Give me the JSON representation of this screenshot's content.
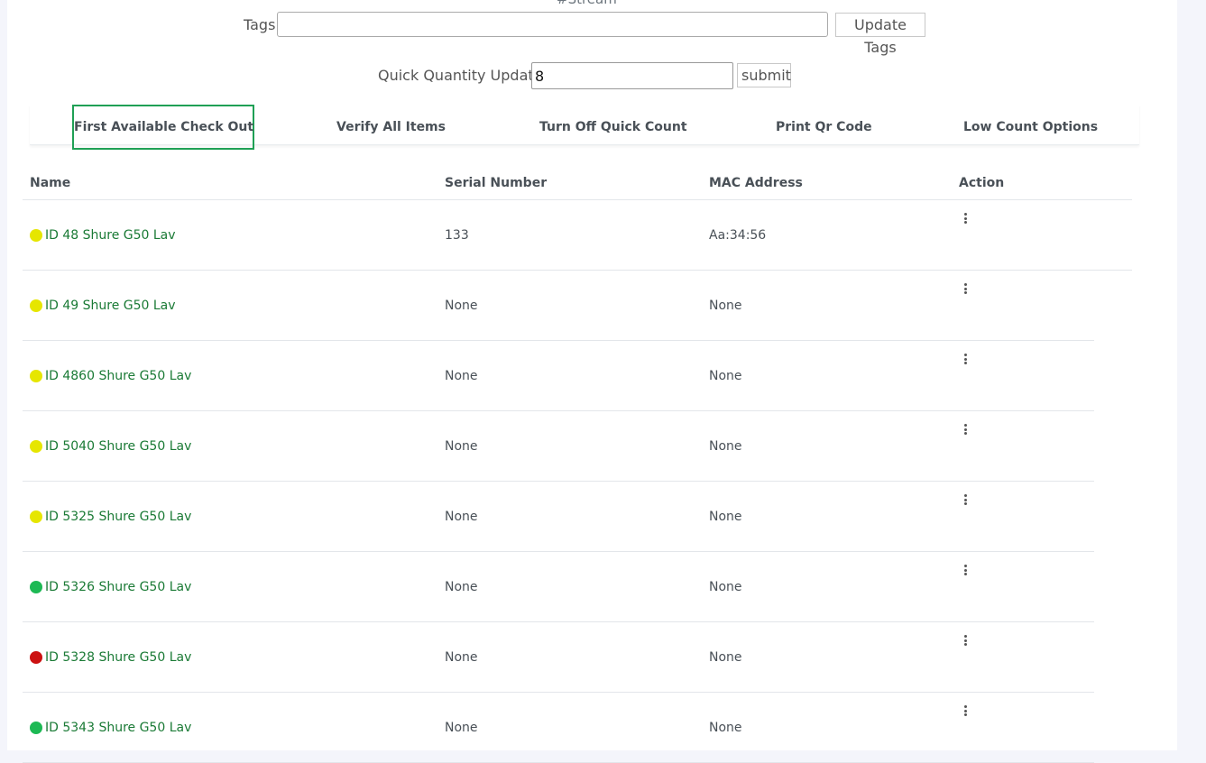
{
  "header": {
    "stream_label": "#Stream",
    "tags_label": "Tags",
    "tags_value": "",
    "update_tags_label": "Update Tags",
    "quick_quantity_label": "Quick Quantity Update",
    "quick_quantity_value": "8",
    "submit_label": "submit"
  },
  "tabs": [
    {
      "label": "First Available Check Out",
      "active": true
    },
    {
      "label": "Verify All Items",
      "active": false
    },
    {
      "label": "Turn Off Quick Count",
      "active": false
    },
    {
      "label": "Print Qr Code",
      "active": false
    },
    {
      "label": "Low Count Options",
      "active": false
    }
  ],
  "table": {
    "columns": [
      "Name",
      "Serial Number",
      "MAC Address",
      "Action"
    ],
    "rows": [
      {
        "name": "ID 48 Shure G50 Lav",
        "serial": "133",
        "mac": "Aa:34:56",
        "status_color": "#e6e600"
      },
      {
        "name": "ID 49 Shure G50 Lav",
        "serial": "None",
        "mac": "None",
        "status_color": "#e6e600"
      },
      {
        "name": "ID 4860 Shure G50 Lav",
        "serial": "None",
        "mac": "None",
        "status_color": "#e6e600"
      },
      {
        "name": "ID 5040 Shure G50 Lav",
        "serial": "None",
        "mac": "None",
        "status_color": "#e6e600"
      },
      {
        "name": "ID 5325 Shure G50 Lav",
        "serial": "None",
        "mac": "None",
        "status_color": "#e6e600"
      },
      {
        "name": "ID 5326 Shure G50 Lav",
        "serial": "None",
        "mac": "None",
        "status_color": "#1db954"
      },
      {
        "name": "ID 5328 Shure G50 Lav",
        "serial": "None",
        "mac": "None",
        "status_color": "#cc1111"
      },
      {
        "name": "ID 5343 Shure G50 Lav",
        "serial": "None",
        "mac": "None",
        "status_color": "#1db954"
      }
    ],
    "action_icon": "kebab-menu-icon"
  },
  "colors": {
    "active_tab_border": "#1fa055",
    "link": "#1a7a35"
  }
}
